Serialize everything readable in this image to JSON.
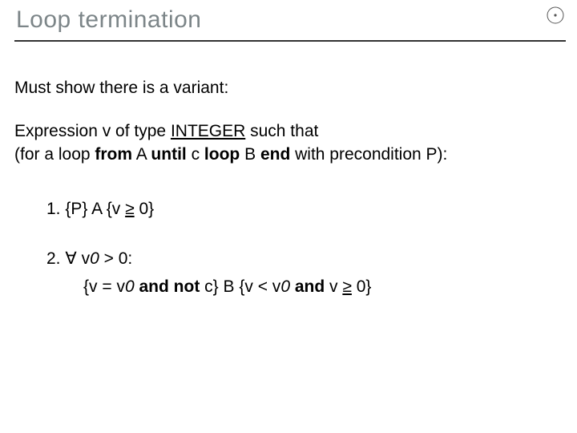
{
  "title": "Loop termination",
  "para1": "Must show there is a variant:",
  "para2": {
    "pre": "Expression v of type ",
    "integer": "INTEGER",
    "post": " such that",
    "line2a": "(for a loop ",
    "k_from": "from",
    "A": " A ",
    "k_until": "until",
    "c": " c ",
    "k_loop": "loop",
    "B": " B  ",
    "k_end": "end",
    "line2b": " with precondition P):"
  },
  "item1": {
    "num": "1. ",
    "a": "{P}  A  {v ",
    "ge": "≥",
    "b": " 0}"
  },
  "item2": {
    "num": "2.  ",
    "forall": "∀",
    "a": " v",
    "zero_a": "0",
    "b": " > 0:",
    "line2a": "{v = v",
    "zero_b": "0",
    "line2b": "  ",
    "k_and1": "and",
    "line2c": "  ",
    "k_not": "not",
    "line2d": " c}  B   {v < v",
    "zero_c": "0",
    "line2e": "  ",
    "k_and2": "and",
    "line2f": "  v ",
    "ge": "≥",
    "line2g": " 0}"
  }
}
